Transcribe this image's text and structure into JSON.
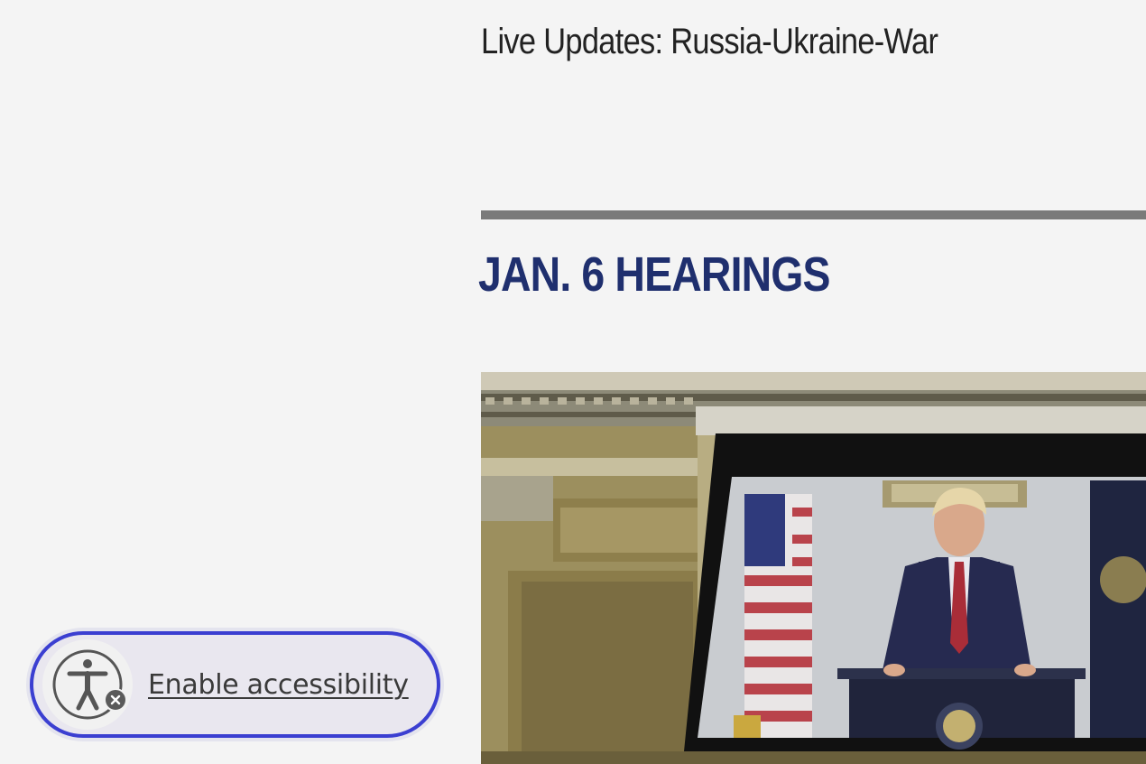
{
  "live_updates": {
    "label": "Live Updates: Russia-Ukraine-War"
  },
  "section": {
    "heading": "JAN. 6 HEARINGS"
  },
  "featured_image": {
    "alt": "Photo of a projection screen showing Donald Trump speaking at a lectern with flags behind him",
    "icon": "image"
  },
  "accessibility_widget": {
    "label": "Enable accessibility",
    "icon": "accessibility-person-icon",
    "close_icon": "close-icon",
    "border_color": "#3b3fd1"
  },
  "colors": {
    "background": "#f4f4f4",
    "heading": "#1f2f6e",
    "divider": "#7a7a7a",
    "link_text": "#222222"
  }
}
